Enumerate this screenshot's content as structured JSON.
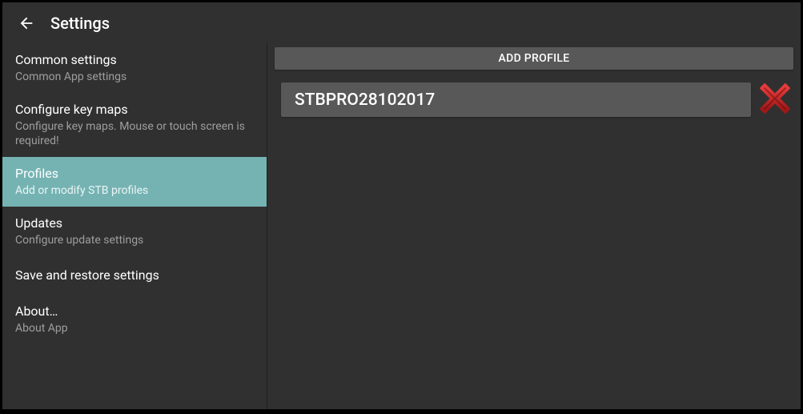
{
  "header": {
    "title": "Settings"
  },
  "sidebar": {
    "items": [
      {
        "label": "Common settings",
        "sub": "Common App settings"
      },
      {
        "label": "Configure key maps",
        "sub": "Configure key maps. Mouse or touch screen is required!"
      },
      {
        "label": "Profiles",
        "sub": "Add or modify STB profiles"
      },
      {
        "label": "Updates",
        "sub": "Configure update settings"
      },
      {
        "label": "Save and restore settings",
        "sub": ""
      },
      {
        "label": "About…",
        "sub": "About App"
      }
    ]
  },
  "content": {
    "add_profile_label": "ADD PROFILE",
    "profiles": [
      {
        "name": "STBPRO28102017"
      }
    ]
  }
}
